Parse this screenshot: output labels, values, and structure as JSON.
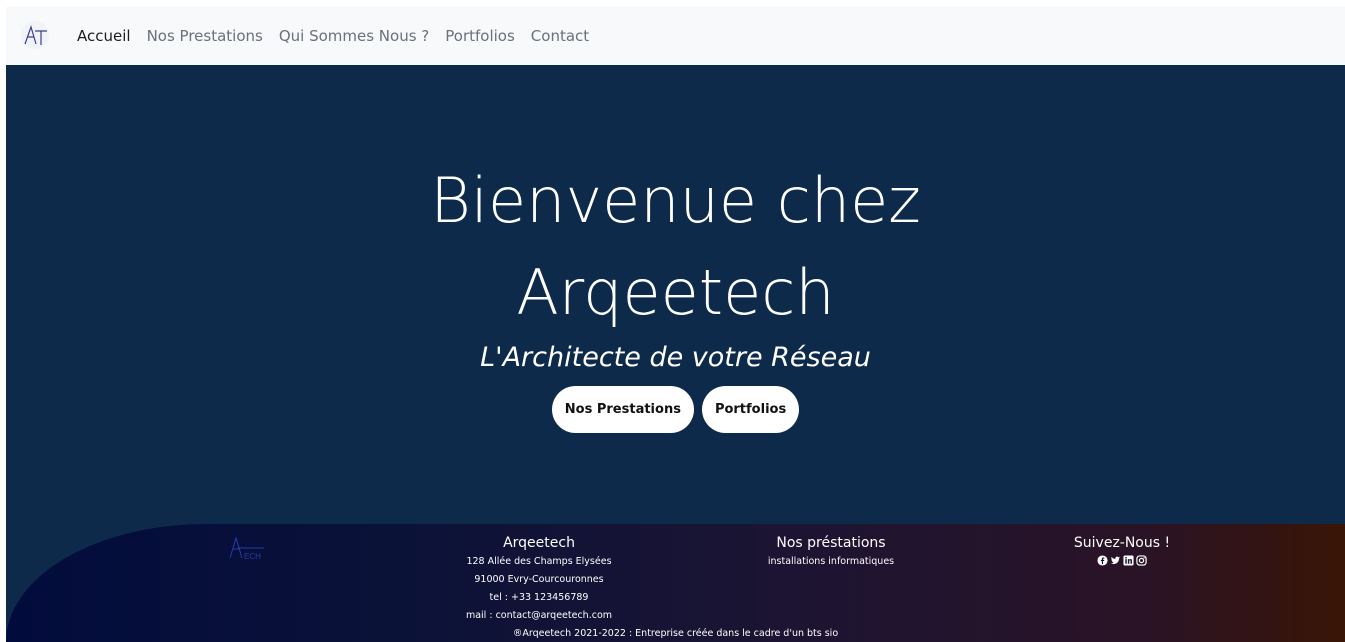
{
  "navbar": {
    "brand_icon": "arqeetech-logo",
    "links": [
      {
        "label": "Accueil",
        "active": true
      },
      {
        "label": "Nos Prestations",
        "active": false
      },
      {
        "label": "Qui Sommes Nous ?",
        "active": false
      },
      {
        "label": "Portfolios",
        "active": false
      },
      {
        "label": "Contact",
        "active": false
      }
    ]
  },
  "hero": {
    "title_line1": "Bienvenue chez",
    "title_line2": "Arqeetech",
    "subtitle": "L'Architecte de votre Réseau",
    "buttons": [
      {
        "label": "Nos Prestations"
      },
      {
        "label": "Portfolios"
      }
    ],
    "background_color": "#0d2a4a"
  },
  "footer": {
    "company": {
      "title": "Arqeetech",
      "address_line1": "128 Allée des Champs Elysées",
      "address_line2": "91000 Evry-Courcouronnes",
      "phone": "tel : +33 123456789",
      "email": "mail : contact@arqeetech.com"
    },
    "services": {
      "title": "Nos préstations",
      "item": "installations informatiques"
    },
    "social": {
      "title": "Suivez-Nous !",
      "icons": [
        "facebook-icon",
        "twitter-icon",
        "linkedin-icon",
        "instagram-icon"
      ]
    },
    "copyright": "®Arqeetech 2021-2022 : Entreprise créée dans le cadre d'un bts sio"
  }
}
